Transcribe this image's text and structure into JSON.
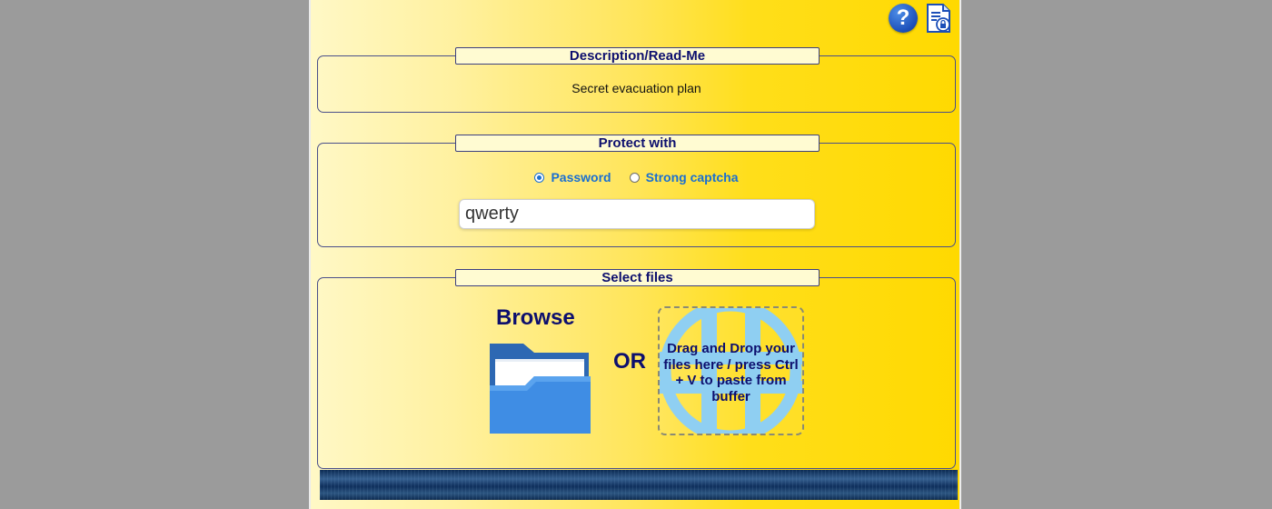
{
  "description": {
    "legend": "Description/Read-Me",
    "text": "Secret evacuation plan"
  },
  "protect": {
    "legend": "Protect with",
    "options": [
      {
        "label": "Password",
        "selected": true
      },
      {
        "label": "Strong captcha",
        "selected": false
      }
    ],
    "password_value": "qwerty"
  },
  "files": {
    "legend": "Select files",
    "browse_label": "Browse",
    "or_label": "OR",
    "drop_text": "Drag and Drop your files here / press Ctrl + V to paste from buffer"
  },
  "icons": {
    "help": "help-icon",
    "document": "protected-document-icon",
    "folder": "folder-icon"
  },
  "colors": {
    "accent": "#0d0f6e",
    "link": "#1a6fd1",
    "panel_start": "#fff8c6",
    "panel_end": "#ffd900"
  }
}
